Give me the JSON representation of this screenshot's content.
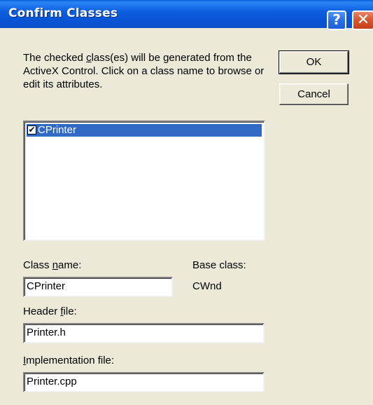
{
  "window": {
    "title": "Confirm Classes",
    "help_glyph": "?",
    "close_glyph": "✕"
  },
  "description": "The checked class(es) will be generated from the ActiveX Control.  Click on a class name to browse or edit its attributes.",
  "description_parts": {
    "pre": "The checked ",
    "accel": "c",
    "post": "lass(es) will be generated from the ActiveX Control.  Click on a class name to browse or edit its attributes."
  },
  "buttons": {
    "ok": "OK",
    "cancel": "Cancel"
  },
  "class_list": {
    "items": [
      {
        "label": "CPrinter",
        "checked": true,
        "selected": true
      }
    ]
  },
  "fields": {
    "class_name": {
      "label_pre": "Class ",
      "label_accel": "n",
      "label_post": "ame:",
      "value": "CPrinter"
    },
    "base_class": {
      "label": "Base class:",
      "value": "CWnd"
    },
    "header_file": {
      "label_pre": "Header ",
      "label_accel": "f",
      "label_post": "ile:",
      "value": "Printer.h"
    },
    "implementation_file": {
      "label_pre": "",
      "label_accel": "I",
      "label_post": "mplementation file:",
      "value": "Printer.cpp"
    }
  },
  "icons": {
    "help": "help-icon",
    "close": "close-icon",
    "checkbox": "checkbox-checked-icon"
  },
  "colors": {
    "titlebar": "#0a55d6",
    "dialog_bg": "#ece9d8",
    "selection": "#316ac5",
    "close_button": "#d9582f"
  }
}
